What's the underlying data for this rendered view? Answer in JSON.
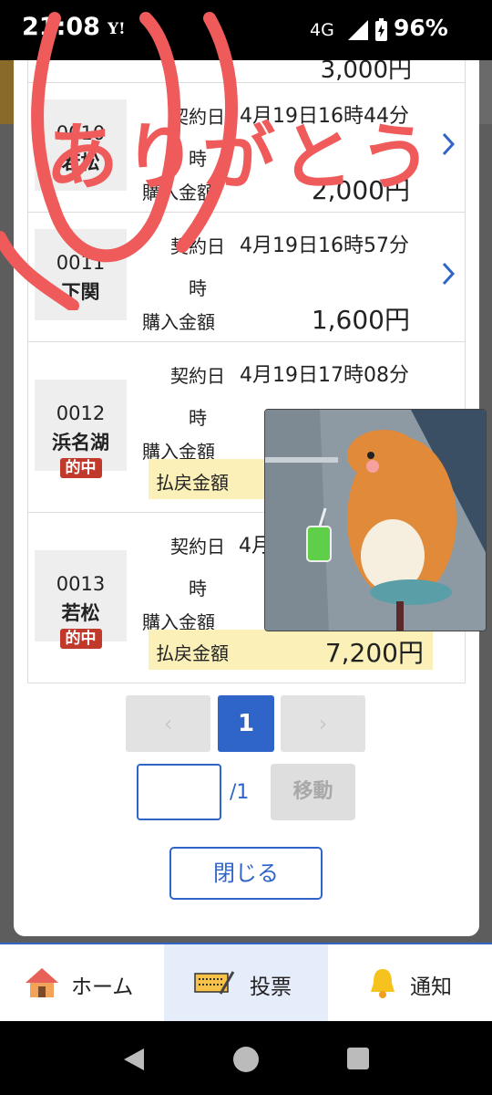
{
  "status_bar": {
    "time": "21:08",
    "carrier_logo": "Y!",
    "network": "4G",
    "battery": "96%"
  },
  "tickets": {
    "partial_top_amount": "3,000円",
    "contract_label": "契約日時",
    "purchase_label": "購入金額",
    "refund_label": "払戻金額",
    "hit_badge": "的中",
    "rows": [
      {
        "id": "0010",
        "venue": "若松",
        "date": "4月19日16時44分",
        "amount": "2,000円"
      },
      {
        "id": "0011",
        "venue": "下関",
        "date": "4月19日16時57分",
        "amount": "1,600円"
      },
      {
        "id": "0012",
        "venue": "浜名湖",
        "date": "4月19日17時08分",
        "amount": "",
        "refund": ""
      },
      {
        "id": "0013",
        "venue": "若松",
        "date": "4月",
        "amount": "",
        "refund": "7,200円"
      }
    ]
  },
  "pagination": {
    "prev": "‹",
    "current": "1",
    "next": "›",
    "input_value": "",
    "total": "/1",
    "move": "移動"
  },
  "close_button": "閉じる",
  "bottom_nav": [
    {
      "label": "ホーム",
      "icon": "home-icon"
    },
    {
      "label": "投票",
      "icon": "ticket-icon",
      "active": true
    },
    {
      "label": "通知",
      "icon": "bell-icon"
    }
  ],
  "overlay_text": "ありがとう",
  "colors": {
    "accent": "#2f64c8",
    "hit": "#c0392b",
    "refund_bg": "#fbf1b8",
    "handwriting": "#ef5a5a"
  }
}
